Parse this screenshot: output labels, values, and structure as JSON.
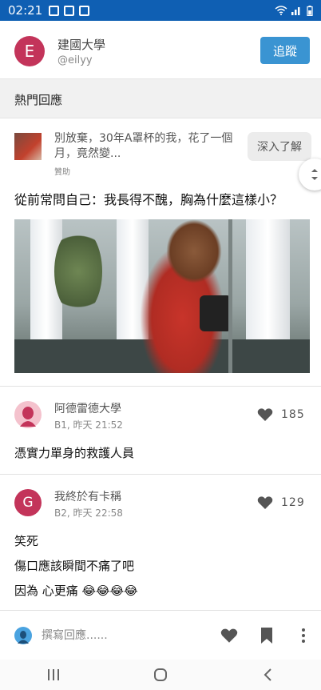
{
  "status_bar": {
    "time": "02:21"
  },
  "header": {
    "avatar_letter": "E",
    "name": "建國大學",
    "handle": "@eilyy",
    "follow_label": "追蹤"
  },
  "section": {
    "title": "熱門回應"
  },
  "ad": {
    "text": "別放棄，30年A罩杯的我，花了一個月，竟然變...",
    "sponsor": "贊助",
    "cta": "深入了解",
    "headline": "從前常問自己：我長得不醜，胸為什麼這樣小？"
  },
  "comments": [
    {
      "author": "阿德雷德大學",
      "floor_time": "B1, 昨天 21:52",
      "likes": "185",
      "lines": [
        "憑實力單身的救護人員"
      ],
      "avatar_color": "#f4c2cd"
    },
    {
      "author": "我終於有卡稱",
      "avatar_letter": "G",
      "floor_time": "B2, 昨天 22:58",
      "likes": "129",
      "lines": [
        "笑死",
        "傷口應該瞬間不痛了吧",
        "因為 心更痛 😂😂😂😂"
      ],
      "avatar_color": "#c3345a"
    }
  ],
  "reply_bar": {
    "placeholder": "撰寫回應......"
  },
  "colors": {
    "brand_blue": "#3a94d2",
    "status_blue": "#0f5fb3"
  },
  "icons": {
    "like": "heart-icon",
    "bookmark": "bookmark-icon",
    "more": "more-vertical-icon",
    "nav": [
      "recents-icon",
      "home-icon",
      "back-icon"
    ]
  }
}
